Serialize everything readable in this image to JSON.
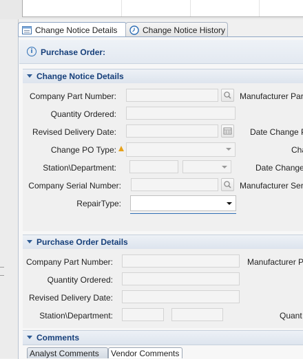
{
  "tabs": [
    {
      "label": "Change Notice Details",
      "icon": "form-icon",
      "active": true
    },
    {
      "label": "Change Notice History",
      "icon": "history-clock-icon",
      "active": false
    }
  ],
  "info_bar": {
    "icon": "info-icon",
    "text": "Purchase Order:"
  },
  "change_notice_section": {
    "title": "Change Notice Details",
    "left_labels": {
      "company_part_number": "Company Part Number:",
      "quantity_ordered": "Quantity Ordered:",
      "revised_delivery_date": "Revised Delivery Date:",
      "change_po_type": "Change PO Type:",
      "station_department": "Station\\Department:",
      "company_serial_number": "Company Serial Number:",
      "repair_type": "RepairType:"
    },
    "right_labels": {
      "manufacturer_part": "Manufacturer Par",
      "date_change_p": "Date Change P",
      "cha": "Cha",
      "date_change": "Date Change",
      "manufacturer_ser": "Manufacturer Ser"
    },
    "repair_type_value": ""
  },
  "purchase_order_section": {
    "title": "Purchase Order Details",
    "left_labels": {
      "company_part_number": "Company Part Number:",
      "quantity_ordered": "Quantity Ordered:",
      "revised_delivery_date": "Revised Delivery Date:",
      "station_department": "Station\\Department:"
    },
    "right_labels": {
      "manufacturer_p": "Manufacturer P",
      "quant": "Quant"
    }
  },
  "comments_section": {
    "title": "Comments",
    "tabs": [
      "Analyst Comments",
      "Vendor Comments"
    ]
  }
}
